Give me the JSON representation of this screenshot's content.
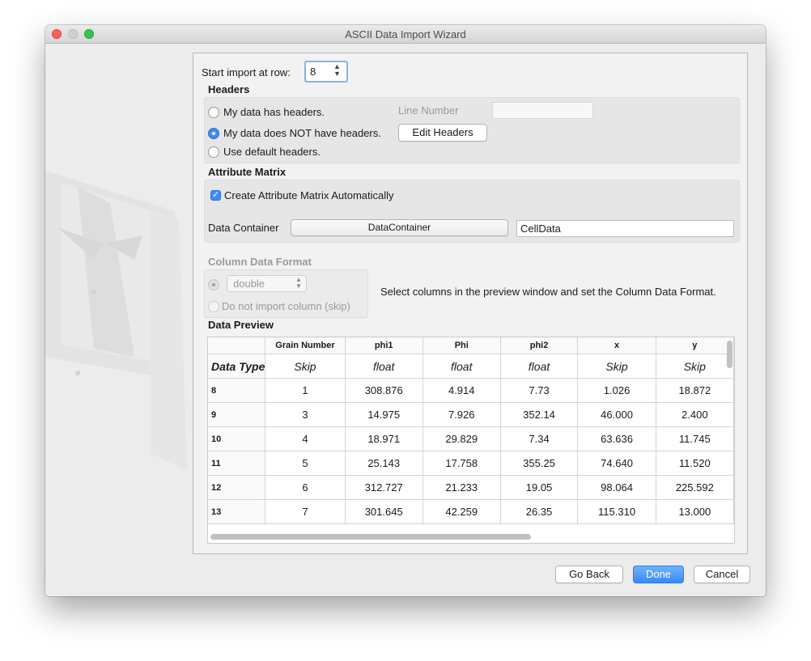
{
  "window": {
    "title": "ASCII Data Import Wizard"
  },
  "start_import": {
    "label": "Start import at row:",
    "value": "8"
  },
  "headers": {
    "title": "Headers",
    "option_has_headers": "My data has headers.",
    "option_no_headers": "My data does NOT have headers.",
    "option_default_headers": "Use default headers.",
    "line_number_label": "Line Number",
    "line_number_value": "",
    "edit_headers_label": "Edit Headers",
    "selected": "no_headers"
  },
  "attribute_matrix": {
    "title": "Attribute Matrix",
    "create_auto_label": "Create Attribute Matrix Automatically",
    "create_auto_checked": true,
    "data_container_label": "Data Container",
    "data_container_button": "DataContainer",
    "matrix_name": "CellData"
  },
  "column_format": {
    "title": "Column Data Format",
    "type_value": "double",
    "skip_label": "Do not import column (skip)",
    "hint": "Select columns in the preview window and set the Column Data Format."
  },
  "preview": {
    "title": "Data Preview",
    "row_header_label": "Data Type",
    "columns": [
      "Grain Number",
      "phi1",
      "Phi",
      "phi2",
      "x",
      "y"
    ],
    "data_types": [
      "Skip",
      "float",
      "float",
      "float",
      "Skip",
      "Skip"
    ],
    "rows": [
      {
        "row": "8",
        "cells": [
          "1",
          "308.876",
          "4.914",
          "7.73",
          "1.026",
          "18.872"
        ]
      },
      {
        "row": "9",
        "cells": [
          "3",
          "14.975",
          "7.926",
          "352.14",
          "46.000",
          "2.400"
        ]
      },
      {
        "row": "10",
        "cells": [
          "4",
          "18.971",
          "29.829",
          "7.34",
          "63.636",
          "11.745"
        ]
      },
      {
        "row": "11",
        "cells": [
          "5",
          "25.143",
          "17.758",
          "355.25",
          "74.640",
          "11.520"
        ]
      },
      {
        "row": "12",
        "cells": [
          "6",
          "312.727",
          "21.233",
          "19.05",
          "98.064",
          "225.592"
        ]
      },
      {
        "row": "13",
        "cells": [
          "7",
          "301.645",
          "42.259",
          "26.35",
          "115.310",
          "13.000"
        ]
      }
    ]
  },
  "footer": {
    "back": "Go Back",
    "done": "Done",
    "cancel": "Cancel"
  },
  "colors": {
    "accent": "#3d8cf3",
    "close": "#fc605c",
    "zoom": "#34c84a"
  }
}
